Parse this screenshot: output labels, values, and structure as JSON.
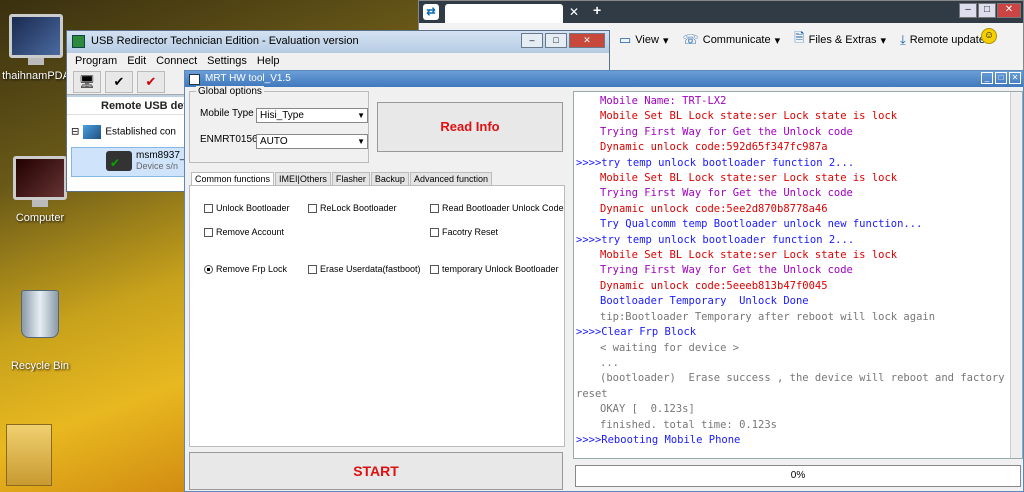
{
  "desktop": {
    "icons": [
      {
        "label": "thaihnamPDA"
      },
      {
        "label": "Computer"
      },
      {
        "label": "Recycle Bin"
      }
    ]
  },
  "teamviewer": {
    "toolbar": [
      {
        "label": "View",
        "icon": "view-icon"
      },
      {
        "label": "Communicate",
        "icon": "communicate-icon"
      },
      {
        "label": "Files & Extras",
        "icon": "files-icon"
      },
      {
        "label": "Remote update",
        "icon": "update-icon"
      }
    ]
  },
  "usb": {
    "title": "USB Redirector Technician Edition - Evaluation version",
    "menu": [
      "Program",
      "Edit",
      "Connect",
      "Settings",
      "Help"
    ],
    "header": "Remote USB devi",
    "tree_item": "Established con",
    "device_name": "msm8937_",
    "device_sub": "Device s/n"
  },
  "mrt": {
    "title": "MRT HW tool_V1.5",
    "global_options": "Global options",
    "mobile_type_label": "Mobile Type",
    "mobile_type_value": "Hisi_Type",
    "enmrt_label": "ENMRT01563",
    "enmrt_value": "AUTO",
    "read_info": "Read Info",
    "tabs": [
      "Common functions",
      "IMEI|Others",
      "Flasher",
      "Backup",
      "Advanced function"
    ],
    "options": {
      "unlock_bootloader": "Unlock Bootloader",
      "relock_bootloader": "ReLock Bootloader",
      "read_unlock_code": "Read Bootloader Unlock Code",
      "remove_account": "Remove Account",
      "factory_reset": "Facotry Reset",
      "remove_frp": "Remove Frp Lock",
      "erase_userdata": "Erase Userdata(fastboot)",
      "temp_unlock": "temporary Unlock Bootloader"
    },
    "start": "START",
    "progress_text": "0%",
    "progress_value": 0,
    "log": [
      {
        "text": "Mobile Name: TRT-LX2",
        "cls": "purple",
        "indent": true
      },
      {
        "text": "Mobile Set BL Lock state:ser Lock state is lock",
        "cls": "red",
        "indent": true
      },
      {
        "text": "Trying First Way for Get the Unlock code",
        "cls": "purple",
        "indent": true
      },
      {
        "text": "Dynamic unlock code:592d65f347fc987a",
        "cls": "red",
        "indent": true
      },
      {
        "text": ">>>>try temp unlock bootloader function 2...",
        "cls": "blue",
        "indent": false
      },
      {
        "text": "Mobile Set BL Lock state:ser Lock state is lock",
        "cls": "red",
        "indent": true
      },
      {
        "text": "Trying First Way for Get the Unlock code",
        "cls": "purple",
        "indent": true
      },
      {
        "text": "Dynamic unlock code:5ee2d870b8778a46",
        "cls": "red",
        "indent": true
      },
      {
        "text": "Try Qualcomm temp Bootloader unlock new function...",
        "cls": "blue",
        "indent": true
      },
      {
        "text": ">>>>try temp unlock bootloader function 2...",
        "cls": "blue",
        "indent": false
      },
      {
        "text": "Mobile Set BL Lock state:ser Lock state is lock",
        "cls": "red",
        "indent": true
      },
      {
        "text": "Trying First Way for Get the Unlock code",
        "cls": "purple",
        "indent": true
      },
      {
        "text": "Dynamic unlock code:5eeeb813b47f0045",
        "cls": "red",
        "indent": true
      },
      {
        "text": "Bootloader Temporary  Unlock Done",
        "cls": "blue",
        "indent": true
      },
      {
        "text": "tip:Bootloader Temporary after reboot will lock again",
        "cls": "gray",
        "indent": true
      },
      {
        "text": ">>>>Clear Frp Block",
        "cls": "blue",
        "indent": false
      },
      {
        "text": "< waiting for device >",
        "cls": "gray",
        "indent": true
      },
      {
        "text": "...",
        "cls": "gray",
        "indent": true
      },
      {
        "text": "(bootloader)  Erase success , the device will reboot and factory",
        "cls": "gray",
        "indent": true
      },
      {
        "text": "reset",
        "cls": "gray",
        "indent": false
      },
      {
        "text": "",
        "cls": "gray",
        "indent": false
      },
      {
        "text": "OKAY [  0.123s]",
        "cls": "gray",
        "indent": true
      },
      {
        "text": "finished. total time: 0.123s",
        "cls": "gray",
        "indent": true
      },
      {
        "text": ">>>>Rebooting Mobile Phone",
        "cls": "blue",
        "indent": false
      }
    ]
  }
}
